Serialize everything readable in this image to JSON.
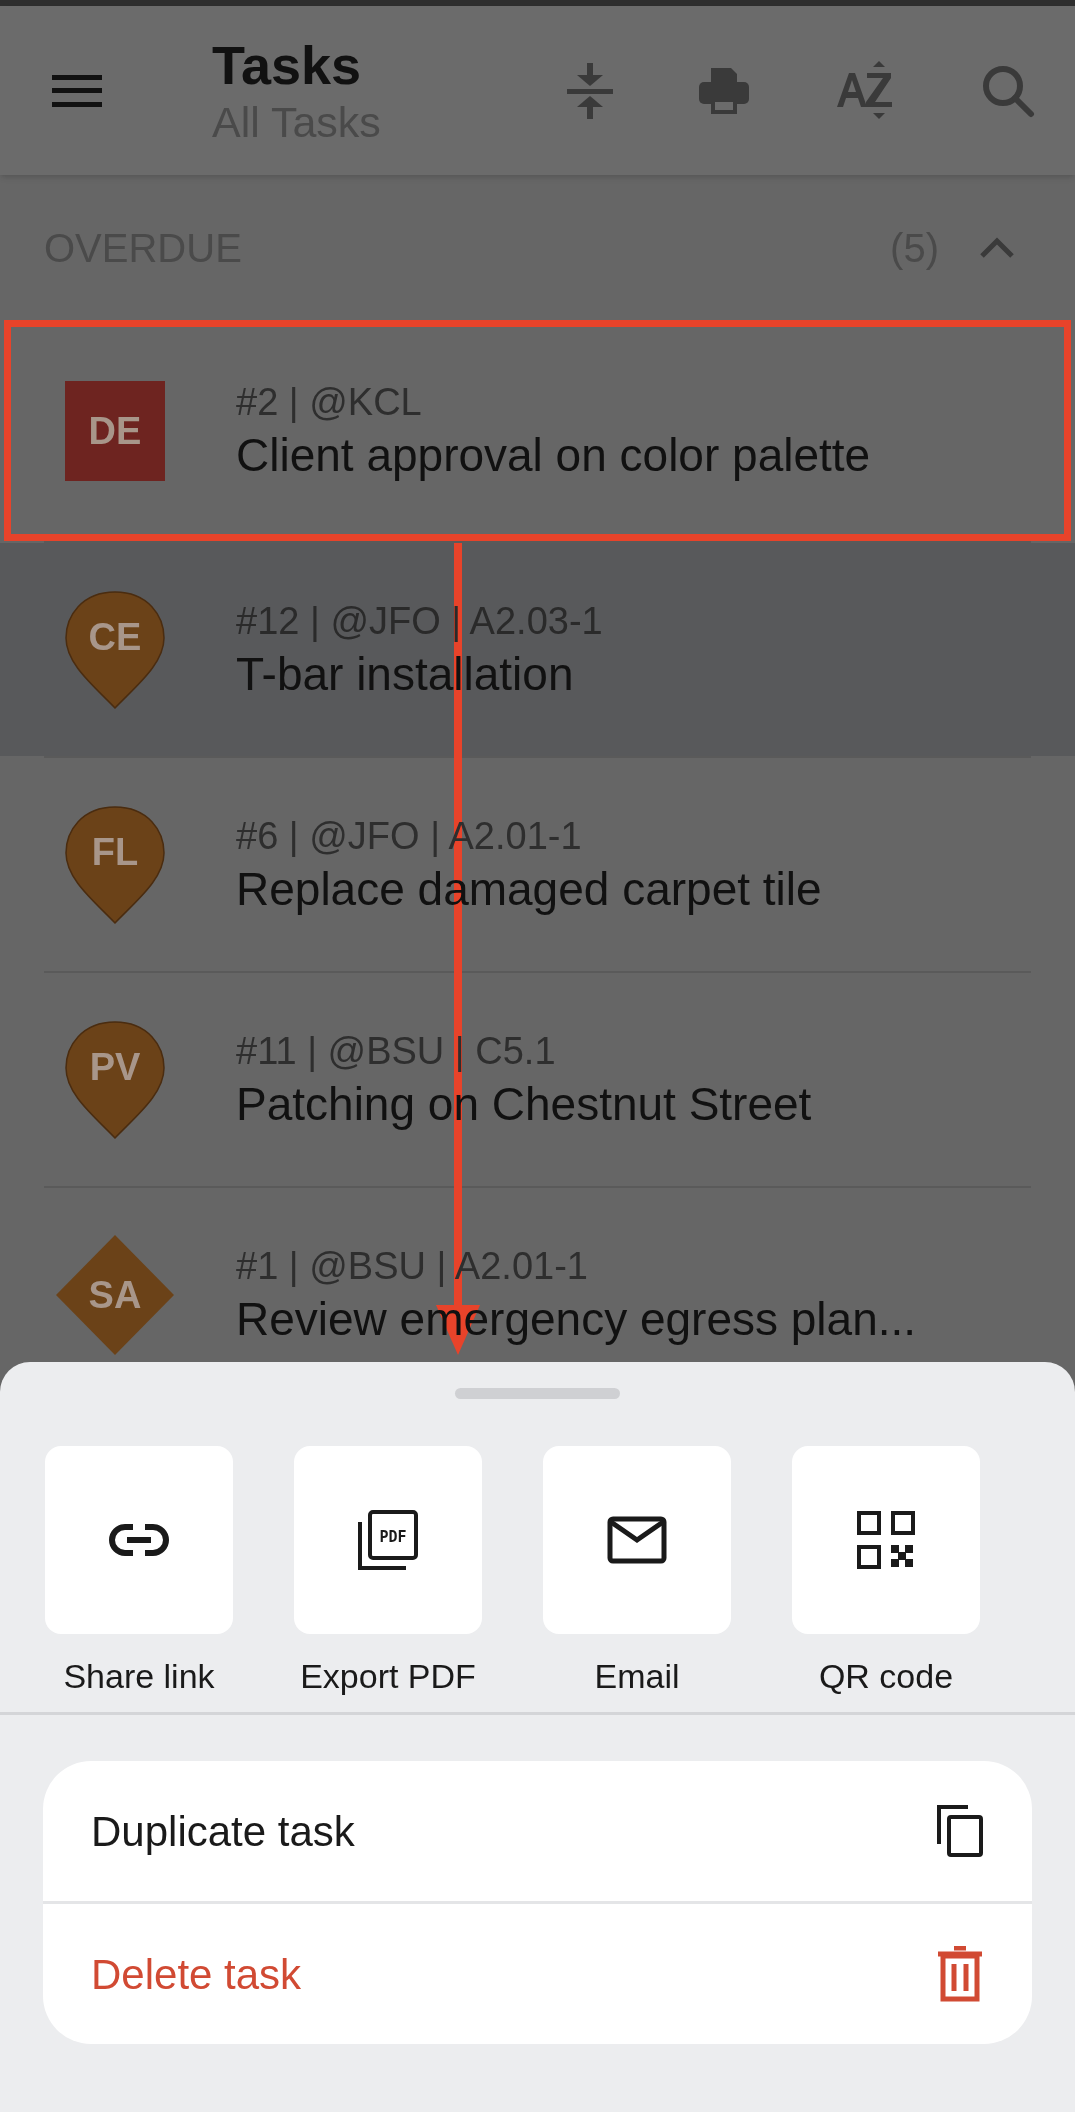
{
  "app_bar": {
    "title": "Tasks",
    "subtitle": "All Tasks"
  },
  "section": {
    "label": "OVERDUE",
    "count": "(5)",
    "expanded": true
  },
  "rows": [
    {
      "avatar": "DE",
      "kind": "square",
      "color": "#6e2420",
      "meta": "#2 | @KCL",
      "title": "Client approval on color palette",
      "selected": false,
      "annotated": true
    },
    {
      "avatar": "CE",
      "kind": "pin",
      "color": "#6b4218",
      "meta": "#12 | @JFO | A2.03-1",
      "title": "T-bar installation",
      "selected": true,
      "annotated": false
    },
    {
      "avatar": "FL",
      "kind": "pin",
      "color": "#6b4218",
      "meta": "#6 | @JFO | A2.01-1",
      "title": "Replace damaged carpet tile",
      "selected": false,
      "annotated": false
    },
    {
      "avatar": "PV",
      "kind": "pin",
      "color": "#6b4218",
      "meta": "#11 | @BSU | C5.1",
      "title": "Patching on Chestnut Street",
      "selected": false,
      "annotated": false
    },
    {
      "avatar": "SA",
      "kind": "diamond",
      "color": "#6b4218",
      "meta": "#1 | @BSU | A2.01-1",
      "title": "Review emergency egress plan...",
      "selected": false,
      "annotated": false
    }
  ],
  "share_actions": [
    {
      "kind": "link",
      "label": "Share link"
    },
    {
      "kind": "pdf",
      "label": "Export PDF",
      "icon_text": "PDF"
    },
    {
      "kind": "email",
      "label": "Email"
    },
    {
      "kind": "qr",
      "label": "QR code"
    }
  ],
  "menu": [
    {
      "kind": "duplicate",
      "label": "Duplicate task",
      "destructive": false
    },
    {
      "kind": "delete",
      "label": "Delete task",
      "destructive": true
    }
  ]
}
